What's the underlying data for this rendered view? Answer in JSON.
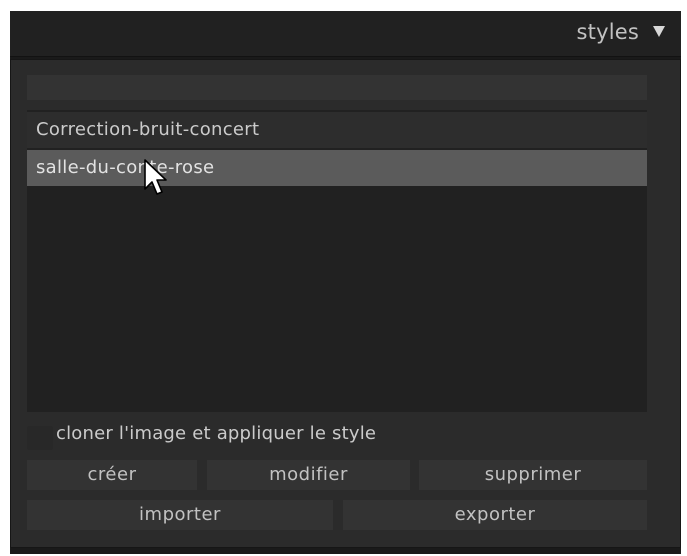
{
  "header": {
    "title": "styles",
    "arrow_icon": "triangle-down-icon"
  },
  "filter": {
    "value": "",
    "placeholder": ""
  },
  "styles_list": {
    "items": [
      {
        "label": "Correction-bruit-concert",
        "selected": false
      },
      {
        "label": "salle-du-conte-rose",
        "selected": true
      }
    ]
  },
  "options": {
    "clone_label": "cloner l'image et appliquer le style",
    "clone_checked": false
  },
  "buttons": {
    "create": "créer",
    "edit": "modifier",
    "delete": "supprimer",
    "import": "importer",
    "export": "exporter"
  },
  "colors": {
    "background": "#2b2b2b",
    "header": "#212121",
    "list_background": "#212121",
    "selected_row": "#5b5b5b",
    "button": "#333333",
    "text": "#c2c2c2"
  }
}
